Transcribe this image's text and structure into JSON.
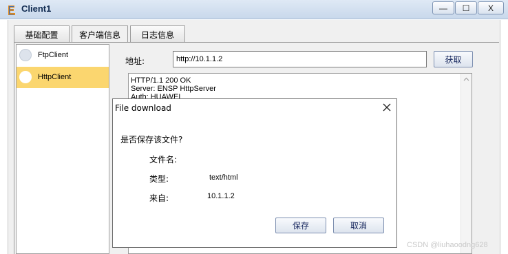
{
  "window": {
    "title": "Client1",
    "min_glyph": "—",
    "max_glyph": "☐",
    "close_glyph": "X"
  },
  "tabs": [
    {
      "label": "基础配置"
    },
    {
      "label": "客户端信息"
    },
    {
      "label": "日志信息"
    }
  ],
  "clients": [
    {
      "label": "FtpClient"
    },
    {
      "label": "HttpClient"
    }
  ],
  "address": {
    "label": "地址:",
    "value": "http://10.1.1.2",
    "fetch_label": "获取"
  },
  "response_lines": [
    "HTTP/1.1 200 OK",
    "Server: ENSP HttpServer",
    "Auth: HUAWEI"
  ],
  "dialog": {
    "title": "File download",
    "question": "是否保存该文件?",
    "filename_label": "文件名:",
    "filename_value": "",
    "type_label": "类型:",
    "type_value": "text/html",
    "from_label": "来自:",
    "from_value": "10.1.1.2",
    "save_label": "保存",
    "cancel_label": "取消"
  },
  "watermark": "CSDN @liuhaoodng628",
  "colors": {
    "selected_item": "#fbd66f",
    "titlebar": "#c8d8eb"
  }
}
